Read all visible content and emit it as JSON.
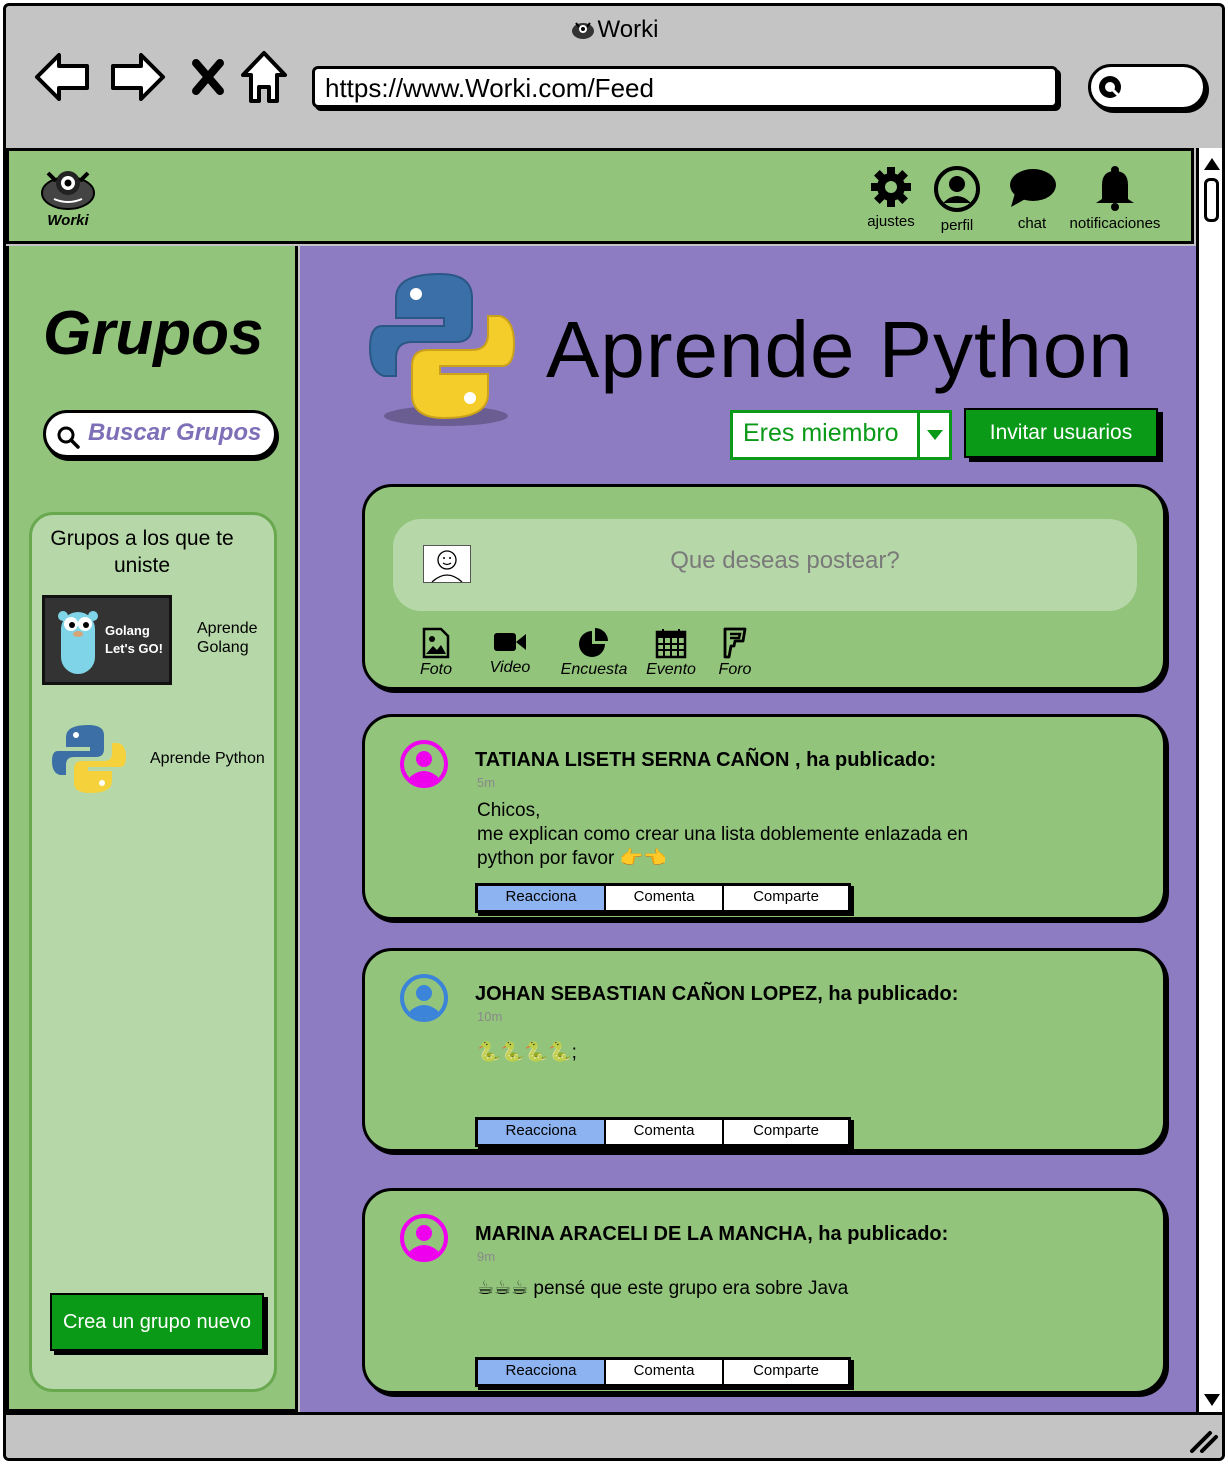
{
  "browser": {
    "title": "Worki",
    "url": "https://www.Worki.com/Feed"
  },
  "header": {
    "brand": "Worki",
    "items": [
      {
        "label": "ajustes",
        "icon": "gear-icon"
      },
      {
        "label": "perfil",
        "icon": "user-circle-icon"
      },
      {
        "label": "chat",
        "icon": "chat-bubble-icon"
      },
      {
        "label": "notificaciones",
        "icon": "bell-icon"
      }
    ]
  },
  "sidebar": {
    "title": "Grupos",
    "search_placeholder": "Buscar Grupos",
    "joined_heading": "Grupos a los que te uniste",
    "groups": [
      {
        "name": "Aprende Golang",
        "thumb_text_1": "Golang",
        "thumb_text_2": "Let's GO!"
      },
      {
        "name": "Aprende Python"
      }
    ],
    "create_label": "Crea un grupo nuevo"
  },
  "group": {
    "title": "Aprende Python",
    "member_label": "Eres miembro",
    "invite_label": "Invitar usuarios"
  },
  "composer": {
    "placeholder": "Que deseas postear?",
    "actions": [
      {
        "label": "Foto",
        "icon": "image-icon"
      },
      {
        "label": "Video",
        "icon": "video-camera-icon"
      },
      {
        "label": "Encuesta",
        "icon": "pie-chart-icon"
      },
      {
        "label": "Evento",
        "icon": "calendar-icon"
      },
      {
        "label": "Foro",
        "icon": "forum-icon"
      }
    ]
  },
  "posts": [
    {
      "author": "TATIANA LISETH SERNA CAÑON , ha publicado:",
      "time": "5m",
      "line1": "Chicos,",
      "line2": "me explican como crear una lista doblemente enlazada en",
      "line3": "python por favor 👉👈",
      "avatar_color": "#ee00ee"
    },
    {
      "author": "JOHAN SEBASTIAN CAÑON LOPEZ, ha publicado:",
      "time": "10m",
      "line1": "🐍🐍🐍🐍;",
      "line2": "",
      "line3": "",
      "avatar_color": "#3b84d9"
    },
    {
      "author": "MARINA ARACELI DE LA MANCHA, ha publicado:",
      "time": "9m",
      "line1": "☕☕☕ pensé que este grupo era sobre Java",
      "line2": "",
      "line3": "",
      "avatar_color": "#ee00ee"
    }
  ],
  "post_actions": {
    "react": "Reacciona",
    "comment": "Comenta",
    "share": "Comparte"
  }
}
